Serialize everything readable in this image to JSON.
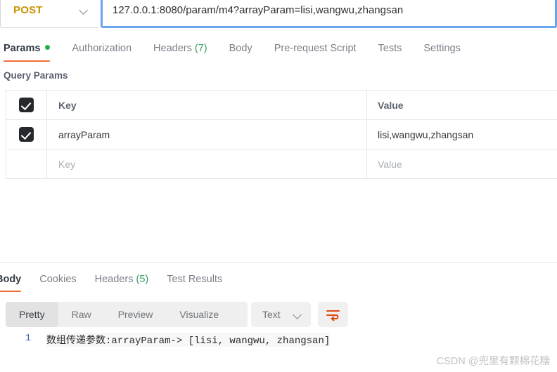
{
  "request": {
    "method": "POST",
    "method_chevron_icon": "chevron-down-icon",
    "url": "127.0.0.1:8080/param/m4?arrayParam=lisi,wangwu,zhangsan",
    "tabs": [
      {
        "label": "Params",
        "active": true,
        "dot": true
      },
      {
        "label": "Authorization",
        "active": false,
        "dot": false
      },
      {
        "label": "Headers",
        "count": "(7)",
        "active": false,
        "dot": false
      },
      {
        "label": "Body",
        "active": false,
        "dot": false
      },
      {
        "label": "Pre-request Script",
        "active": false,
        "dot": false
      },
      {
        "label": "Tests",
        "active": false,
        "dot": false
      },
      {
        "label": "Settings",
        "active": false,
        "dot": false
      }
    ]
  },
  "query_params": {
    "title": "Query Params",
    "columns": {
      "key": "Key",
      "value": "Value"
    },
    "rows": [
      {
        "checked": true,
        "key": "arrayParam",
        "value": "lisi,wangwu,zhangsan"
      },
      {
        "checked": false,
        "key_placeholder": "Key",
        "value_placeholder": "Value"
      }
    ]
  },
  "response": {
    "tabs": [
      {
        "label": "Body",
        "active": true
      },
      {
        "label": "Cookies",
        "active": false
      },
      {
        "label": "Headers",
        "count": "(5)",
        "active": false
      },
      {
        "label": "Test Results",
        "active": false
      }
    ],
    "viewer_modes": [
      {
        "label": "Pretty",
        "selected": true
      },
      {
        "label": "Raw",
        "selected": false
      },
      {
        "label": "Preview",
        "selected": false
      },
      {
        "label": "Visualize",
        "selected": false
      }
    ],
    "format": {
      "label": "Text",
      "chevron_icon": "chevron-down-icon"
    },
    "wrap_icon": "word-wrap-icon",
    "body": {
      "line_number": "1",
      "text": "数组传递参数:arrayParam-> [lisi, wangwu, zhangsan]"
    }
  },
  "watermark": "CSDN @兜里有颗棉花糖",
  "colors": {
    "method_accent": "#c99100",
    "tab_active_underline": "#f26b37",
    "count_badge": "#2f9e5e",
    "dot_green": "#23b14d",
    "focus_border": "#6ba5ee",
    "wrap_icon": "#e04a13"
  }
}
